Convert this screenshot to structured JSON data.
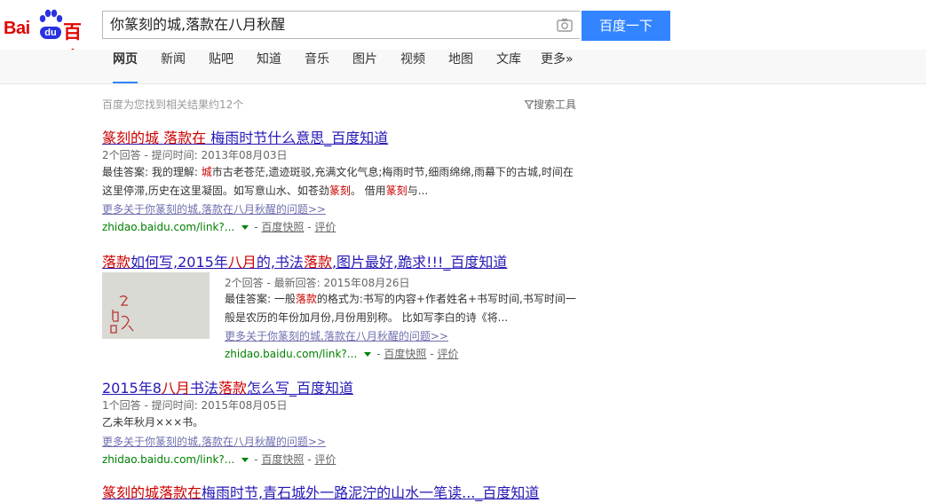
{
  "logo": {
    "bai": "Bai",
    "du": "du",
    "baidu": "百度"
  },
  "search": {
    "query": "你篆刻的城,落款在八月秋醒",
    "button": "百度一下"
  },
  "nav": [
    "网页",
    "新闻",
    "贴吧",
    "知道",
    "音乐",
    "图片",
    "视频",
    "地图",
    "文库",
    "更多»"
  ],
  "stats": {
    "count_text": "百度为您找到相关结果约12个",
    "tools": "搜索工具"
  },
  "results": [
    {
      "title_parts": [
        {
          "t": "篆刻的城",
          "em": true
        },
        {
          "t": " ",
          "em": false
        },
        {
          "t": "落款在",
          "em": true
        },
        {
          "t": " 梅雨时节什么意思_百度知道",
          "em": false
        }
      ],
      "meta": "2个回答 - 提问时间: 2013年08月03日",
      "abstract_parts": [
        {
          "t": "最佳答案: 我的理解: ",
          "em": false
        },
        {
          "t": "城",
          "em": true
        },
        {
          "t": "市古老苍茫,遗迹斑驳,充满文化气息;梅雨时节,细雨绵绵,雨幕下的古城,时间在这里停滞,历史在这里凝固。如写意山水、如苍劲",
          "em": false
        },
        {
          "t": "篆刻",
          "em": true
        },
        {
          "t": "。 借用",
          "em": false
        },
        {
          "t": "篆刻",
          "em": true
        },
        {
          "t": "与...",
          "em": false
        }
      ],
      "more": "更多关于你篆刻的城,落款在八月秋醒的问题>>",
      "url": "zhidao.baidu.com/link?...",
      "snapshot": "百度快照",
      "rate": "评价"
    },
    {
      "title_parts": [
        {
          "t": "落款",
          "em": true
        },
        {
          "t": "如何写,2015年",
          "em": false
        },
        {
          "t": "八月",
          "em": true
        },
        {
          "t": "的,书法",
          "em": false
        },
        {
          "t": "落款",
          "em": true
        },
        {
          "t": ",图片最好,跪求!!!_百度知道",
          "em": false
        }
      ],
      "meta": "2个回答 - 最新回答: 2015年08月26日",
      "abstract_parts": [
        {
          "t": "最佳答案: 一般",
          "em": false
        },
        {
          "t": "落款",
          "em": true
        },
        {
          "t": "的格式为:书写的内容+作者姓名+书写时间,书写时间一般是农历的年份加月份,月份用别称。 比如写李白的诗《将...",
          "em": false
        }
      ],
      "more": "更多关于你篆刻的城,落款在八月秋醒的问题>>",
      "url": "zhidao.baidu.com/link?...",
      "snapshot": "百度快照",
      "rate": "评价"
    },
    {
      "title_parts": [
        {
          "t": "2015年8",
          "em": false
        },
        {
          "t": "八月",
          "em": true
        },
        {
          "t": "书法",
          "em": false
        },
        {
          "t": "落款",
          "em": true
        },
        {
          "t": "怎么写_百度知道",
          "em": false
        }
      ],
      "meta": "1个回答 - 提问时间: 2015年08月05日",
      "abstract_parts": [
        {
          "t": "乙未年秋月×××书。",
          "em": false
        }
      ],
      "more": "更多关于你篆刻的城,落款在八月秋醒的问题>>",
      "url": "zhidao.baidu.com/link?...",
      "snapshot": "百度快照",
      "rate": "评价"
    },
    {
      "title_parts": [
        {
          "t": "篆刻的城落款在",
          "em": true
        },
        {
          "t": "梅雨时节,青石城外一路泥泞的山水一笔读..._百度知道",
          "em": false
        }
      ]
    }
  ],
  "colors": {
    "accent": "#3385ff",
    "title_link": "#2518b5",
    "highlight": "#cc0000",
    "url_green": "#008000"
  }
}
